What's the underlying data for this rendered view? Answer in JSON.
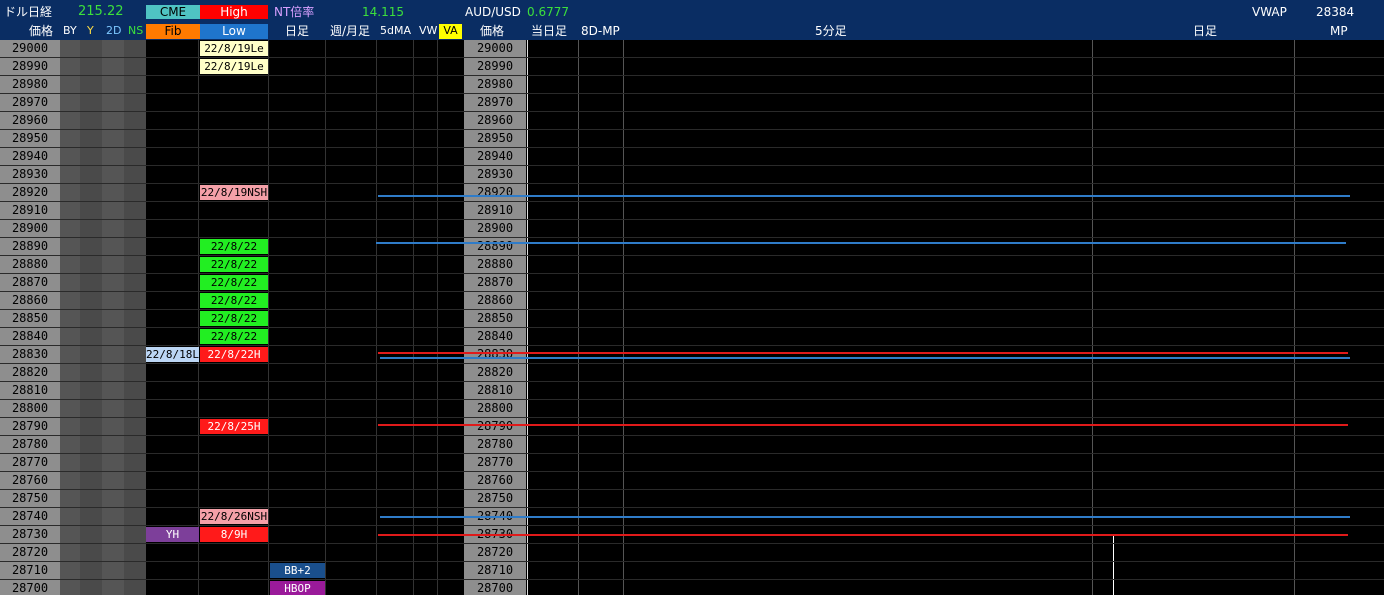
{
  "header": {
    "title": "ドル日経",
    "title_value": "215.22",
    "cme_label": "CME",
    "high_label": "High",
    "nt_label": "NT倍率",
    "nt_value": "14.115",
    "aud_label": "AUD/USD",
    "aud_value": "0.6777",
    "vwap_label": "VWAP",
    "vwap_value": "28384",
    "cols": {
      "price": "価格",
      "by": "BY",
      "y": "Y",
      "twod": "2D",
      "ns": "NS",
      "fib": "Fib",
      "low": "Low",
      "daily": "日足",
      "weekly_monthly": "週/月足",
      "fivedma": "5dMA",
      "vw": "VW",
      "va": "VA",
      "price2": "価格",
      "today": "当日足",
      "eightdmp": "8D-MP",
      "fivemin": "5分足",
      "daily2": "日足",
      "mp": "MP"
    }
  },
  "prices": [
    "29000",
    "28990",
    "28980",
    "28970",
    "28960",
    "28950",
    "28940",
    "28930",
    "28920",
    "28910",
    "28900",
    "28890",
    "28880",
    "28870",
    "28860",
    "28850",
    "28840",
    "28830",
    "28820",
    "28810",
    "28800",
    "28790",
    "28780",
    "28770",
    "28760",
    "28750",
    "28740",
    "28730",
    "28720",
    "28710",
    "28700"
  ],
  "markers": {
    "low_29000": "22/8/19Le",
    "low_28990": "22/8/19Le",
    "low_28920": "22/8/19NSH",
    "low_28890": "22/8/22",
    "low_28880": "22/8/22",
    "low_28870": "22/8/22",
    "low_28860": "22/8/22",
    "low_28850": "22/8/22",
    "low_28840": "22/8/22",
    "low_28830": "22/8/22H",
    "fib_28830": "22/8/18L",
    "low_28790": "22/8/25H",
    "low_28740": "22/8/26NSH",
    "fib_28730": "YH",
    "low_28730": "8/9H",
    "daily_28710": "BB+2",
    "daily_28700": "HBOP"
  },
  "colors": {
    "header_bg": "#0a2d63",
    "row_gray": "#8e8e8e",
    "cme_cyan": "#4fc3c3",
    "high_red": "#ff0000",
    "fib_orange": "#ff7a00",
    "low_blue": "#1f75cc",
    "va_yellow": "#ffff00",
    "green": "#00dd00",
    "marker_red": "#ff1a1a",
    "marker_pink": "#f4a0a8",
    "marker_yellow": "#ffffc8",
    "marker_lightblue": "#bcd6f5",
    "marker_purple": "#7d3f9a",
    "line_blue": "#2f7cc9",
    "line_red": "#e01a1a"
  }
}
